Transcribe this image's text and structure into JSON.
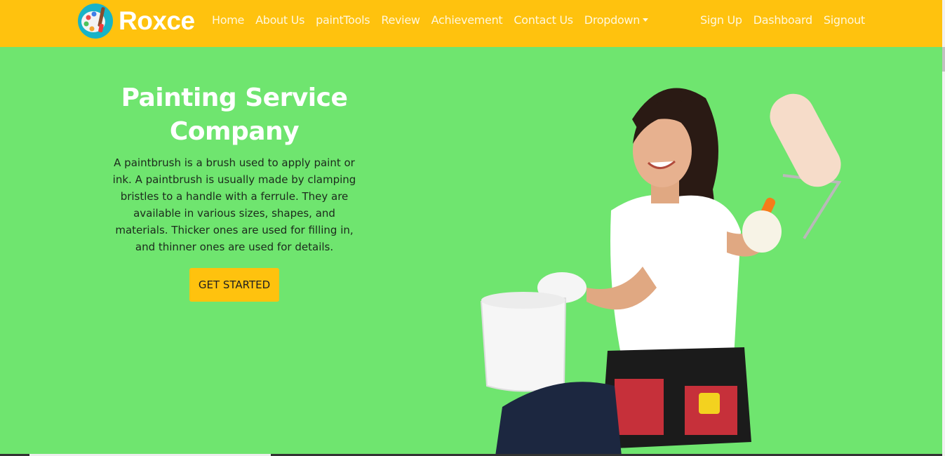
{
  "brand": {
    "name": "Roxce",
    "logo_icon": "palette-logo-icon"
  },
  "nav": {
    "left": [
      "Home",
      "About Us",
      "paintTools",
      "Review",
      "Achievement",
      "Contact Us",
      "Dropdown"
    ],
    "right": [
      "Sign Up",
      "Dashboard",
      "Signout"
    ]
  },
  "hero": {
    "title_line1": "Painting Service",
    "title_line2": "Company",
    "description": "A paintbrush is a brush used to apply paint or ink. A paintbrush is usually made by clamping bristles to a handle with a ferrule. They are available in various sizes, shapes, and materials. Thicker ones are used for filling in, and thinner ones are used for details.",
    "cta": "GET STARTED"
  },
  "colors": {
    "navbar": "#ffc20e",
    "hero_bg": "#6fe56f",
    "cta_bg": "#ffc20e"
  }
}
